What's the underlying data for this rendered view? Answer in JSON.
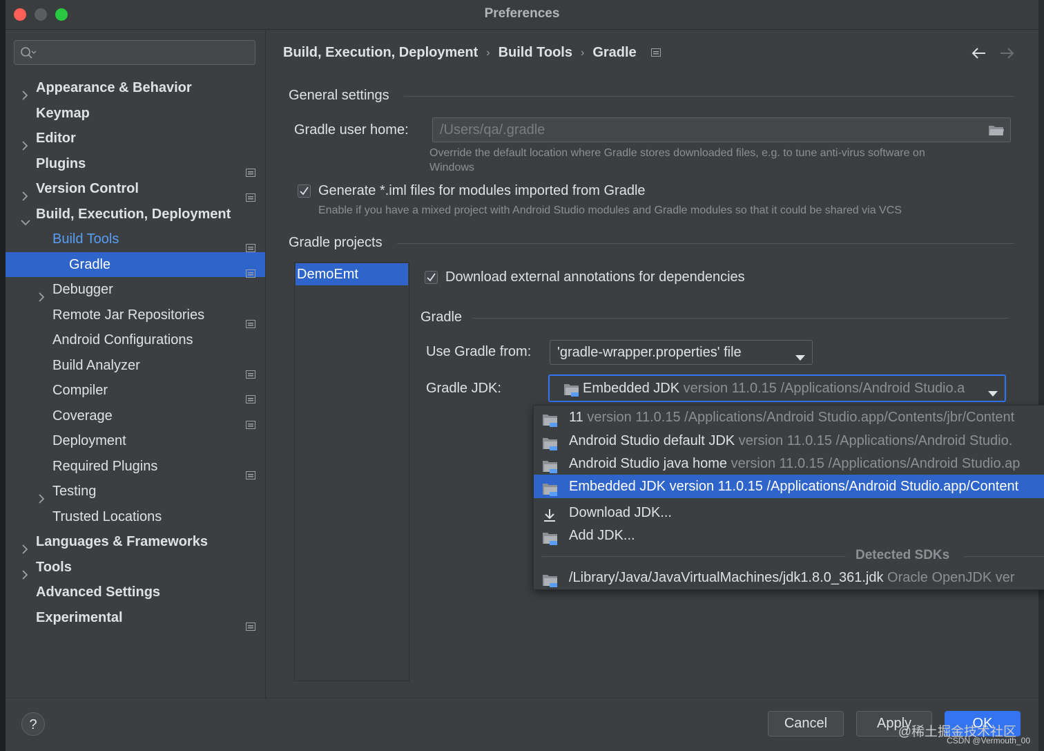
{
  "window": {
    "title": "Preferences"
  },
  "search": {
    "placeholder": ""
  },
  "sidebar": {
    "items": [
      {
        "label": "Appearance & Behavior",
        "expandable": true
      },
      {
        "label": "Keymap"
      },
      {
        "label": "Editor",
        "expandable": true
      },
      {
        "label": "Plugins",
        "project_scoped": true
      },
      {
        "label": "Version Control",
        "expandable": true,
        "project_scoped": true
      },
      {
        "label": "Build, Execution, Deployment",
        "expandable": true,
        "expanded": true
      },
      {
        "label": "Build Tools",
        "expanded": true,
        "project_scoped": true
      },
      {
        "label": "Gradle",
        "selected": true,
        "project_scoped": true
      },
      {
        "label": "Debugger",
        "expandable": true
      },
      {
        "label": "Remote Jar Repositories",
        "project_scoped": true
      },
      {
        "label": "Android Configurations"
      },
      {
        "label": "Build Analyzer",
        "project_scoped": true
      },
      {
        "label": "Compiler",
        "project_scoped": true
      },
      {
        "label": "Coverage",
        "project_scoped": true
      },
      {
        "label": "Deployment"
      },
      {
        "label": "Required Plugins",
        "project_scoped": true
      },
      {
        "label": "Testing",
        "expandable": true
      },
      {
        "label": "Trusted Locations"
      },
      {
        "label": "Languages & Frameworks",
        "expandable": true
      },
      {
        "label": "Tools",
        "expandable": true
      },
      {
        "label": "Advanced Settings"
      },
      {
        "label": "Experimental",
        "project_scoped": true
      }
    ]
  },
  "breadcrumb": [
    "Build, Execution, Deployment",
    "Build Tools",
    "Gradle"
  ],
  "general": {
    "title": "General settings",
    "gradle_home_label": "Gradle user home:",
    "gradle_home_placeholder": "/Users/qa/.gradle",
    "gradle_home_hint_line1": "Override the default location where Gradle stores downloaded files, e.g. to tune anti-virus software on",
    "gradle_home_hint_line2": "Windows",
    "iml_checkbox_label": "Generate *.iml files for modules imported from Gradle",
    "iml_checked": true,
    "iml_hint": "Enable if you have a mixed project with Android Studio modules and Gradle modules so that it could be shared via VCS"
  },
  "projects": {
    "title": "Gradle projects",
    "list": [
      "DemoEmt"
    ],
    "annotations_label": "Download external annotations for dependencies",
    "annotations_checked": true,
    "gradle_section_title": "Gradle",
    "use_gradle_from_label": "Use Gradle from:",
    "use_gradle_from_value": "'gradle-wrapper.properties' file",
    "gradle_jdk_label": "Gradle JDK:",
    "gradle_jdk_name": "Embedded JDK",
    "gradle_jdk_detail": "version 11.0.15 /Applications/Android Studio.a"
  },
  "jdk_popup": {
    "items": [
      {
        "name": "11",
        "detail": "version 11.0.15 /Applications/Android Studio.app/Contents/jbr/Content",
        "icon": "folder-icon"
      },
      {
        "name": "Android Studio default JDK",
        "detail": "version 11.0.15 /Applications/Android Studio.",
        "icon": "folder-icon"
      },
      {
        "name": "Android Studio java home",
        "detail": "version 11.0.15 /Applications/Android Studio.ap",
        "icon": "folder-icon"
      },
      {
        "name": "Embedded JDK version 11.0.15 /Applications/Android Studio.app/Content",
        "detail": "",
        "icon": "folder-icon",
        "selected": true
      },
      {
        "name": "Download JDK...",
        "detail": "",
        "icon": "download-icon"
      },
      {
        "name": "Add JDK...",
        "detail": "",
        "icon": "folder-icon"
      }
    ],
    "detected_title": "Detected SDKs",
    "detected": [
      {
        "name": "/Library/Java/JavaVirtualMachines/jdk1.8.0_361.jdk",
        "detail": "Oracle OpenJDK ver",
        "icon": "folder-icon"
      }
    ]
  },
  "footer": {
    "help": "?",
    "cancel": "Cancel",
    "apply": "Apply",
    "ok": "OK",
    "watermark": "@稀土掘金技术社区",
    "credit": "CSDN @Vermouth_00"
  },
  "colors": {
    "accent": "#2f65ca",
    "link": "#589df6",
    "background": "#3c3f41"
  }
}
